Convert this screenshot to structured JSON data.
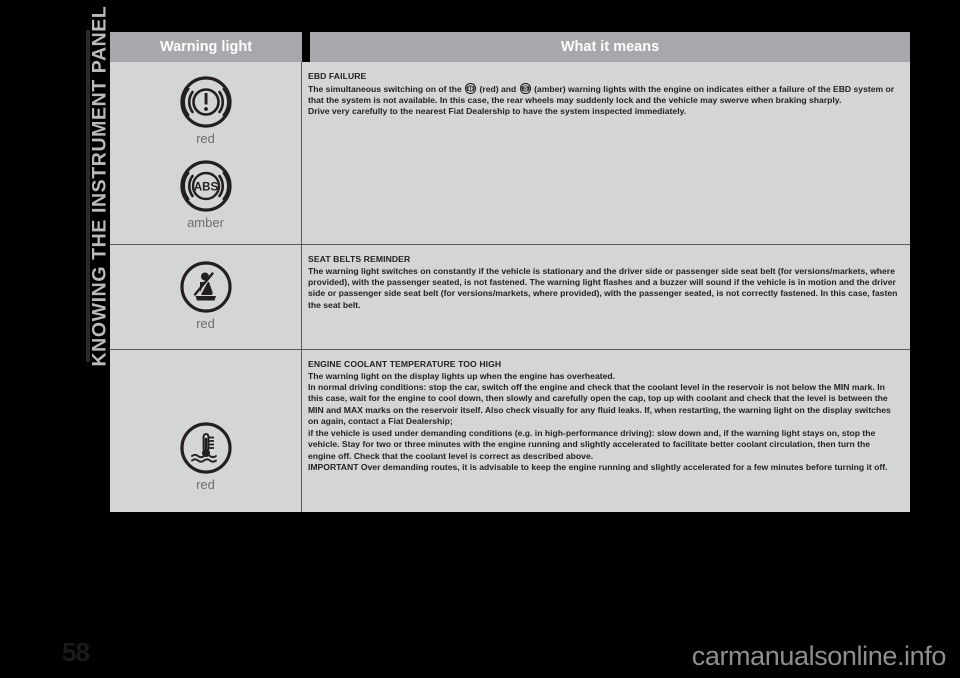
{
  "chapter": {
    "title": "KNOWING THE INSTRUMENT PANEL"
  },
  "page": {
    "number": "58",
    "watermark": "carmanualsonline.info"
  },
  "table": {
    "headers": {
      "warning_light": "Warning light",
      "what_it_means": "What it means"
    },
    "rows": [
      {
        "lamps": [
          {
            "icon": "brake-warning-icon",
            "color_label": "red"
          },
          {
            "icon": "abs-warning-icon",
            "color_label": "amber"
          }
        ],
        "heading": "EBD FAILURE",
        "paragraphs": [
          "The simultaneous switching on of the  (red) and  (amber) warning lights with the engine on indicates either a failure of the EBD system or that the system is not available. In this case, the rear wheels may suddenly lock and the vehicle may swerve when braking sharply.",
          "Drive very carefully to the nearest Fiat Dealership to have the system inspected immediately."
        ]
      },
      {
        "lamps": [
          {
            "icon": "seat-belt-reminder-icon",
            "color_label": "red"
          }
        ],
        "heading": "SEAT BELTS REMINDER",
        "paragraphs": [
          "The warning light switches on constantly if the vehicle is stationary and the driver side or passenger side seat belt (for versions/markets, where provided), with the passenger seated, is not fastened. The warning light flashes and a buzzer will sound if the vehicle is in motion and the driver side or passenger side seat belt (for versions/markets, where provided), with the passenger seated, is not correctly fastened. In this case, fasten the seat belt."
        ]
      },
      {
        "lamps": [
          {
            "icon": "coolant-temperature-icon",
            "color_label": "red"
          }
        ],
        "heading": "ENGINE COOLANT TEMPERATURE TOO HIGH",
        "paragraphs": [
          "The warning light on the display lights up when the engine has overheated.",
          "In normal driving conditions: stop the car, switch off the engine and check that the coolant level in the reservoir is not below the MIN mark. In this case, wait for the engine to cool down, then slowly and carefully open the cap, top up with coolant and check that the level is between the MIN and MAX marks on the reservoir itself. Also check visually for any fluid leaks. If, when restarting, the warning light on the display switches on again, contact a Fiat Dealership;",
          "if the vehicle is used under demanding conditions (e.g. in high-performance driving): slow down and, if the warning light stays on, stop the vehicle. Stay for two or three minutes with the engine running and slightly accelerated to facilitate better coolant circulation, then turn the engine off. Check that the coolant level is correct as described above.",
          "IMPORTANT Over demanding routes, it is advisable to keep the engine running and slightly accelerated for a few minutes before turning it off."
        ]
      }
    ]
  }
}
